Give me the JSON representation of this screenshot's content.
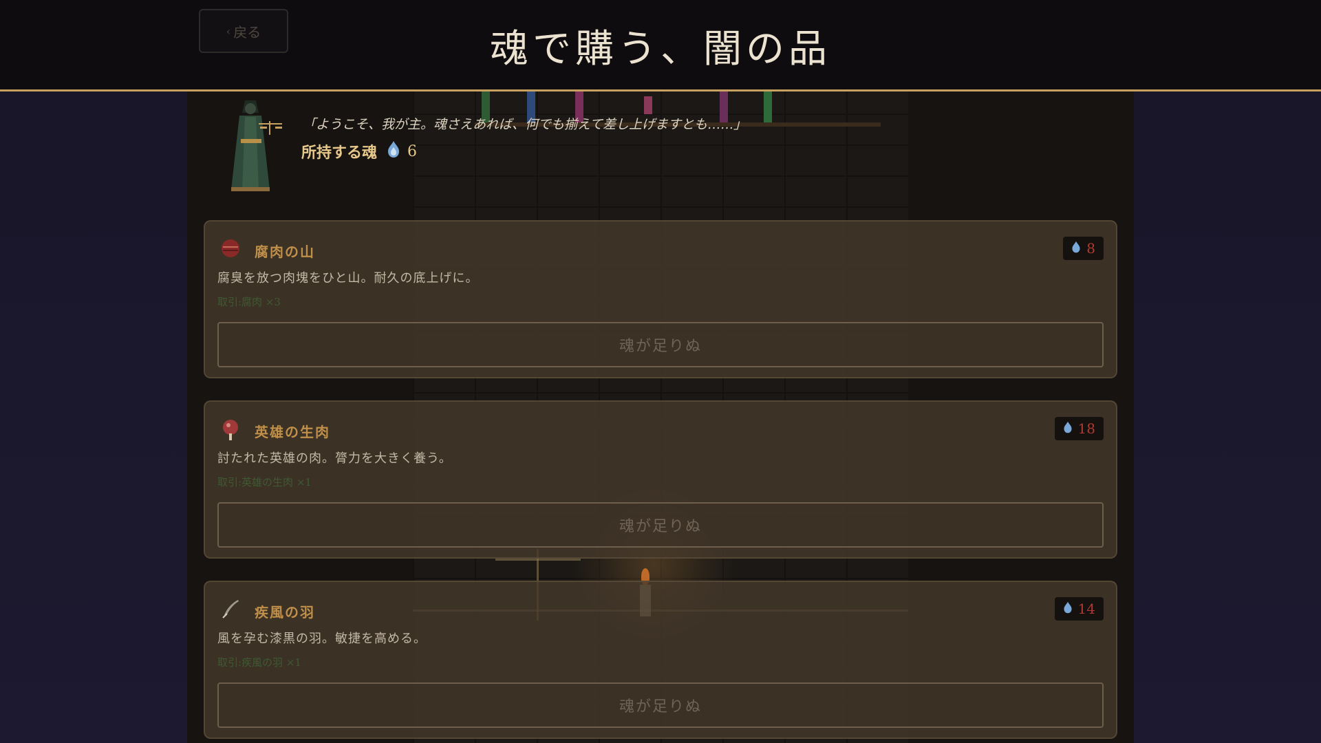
{
  "header": {
    "back_label": "戻る",
    "title": "魂で購う、闇の品"
  },
  "merchant": {
    "speech": "「ようこそ、我が主。魂さえあれば、何でも揃えて差し上げますとも……」",
    "souls_label": "所持する魂",
    "souls_count": "6"
  },
  "items": [
    {
      "name": "腐肉の山",
      "description": "腐臭を放つ肉塊をひと山。耐久の底上げに。",
      "stock": "取引:腐肉 ×3",
      "price": "8",
      "button": "魂が足りぬ",
      "icon": "rotten-meat-icon"
    },
    {
      "name": "英雄の生肉",
      "description": "討たれた英雄の肉。膂力を大きく養う。",
      "stock": "取引:英雄の生肉 ×1",
      "price": "18",
      "button": "魂が足りぬ",
      "icon": "raw-meat-icon"
    },
    {
      "name": "疾風の羽",
      "description": "風を孕む漆黒の羽。敏捷を高める。",
      "stock": "取引:疾風の羽 ×1",
      "price": "14",
      "button": "魂が足りぬ",
      "icon": "feather-icon"
    }
  ],
  "colors": {
    "accent": "#c8a060",
    "price_insufficient": "#b23a32",
    "soul_flame": "#7aa8d8"
  }
}
